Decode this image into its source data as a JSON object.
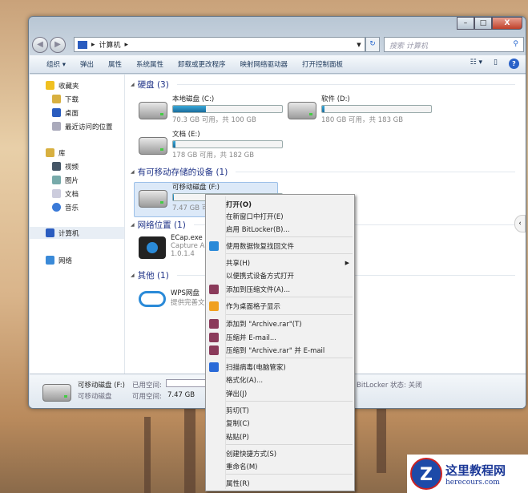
{
  "window": {
    "controls": {
      "minimize": "–",
      "maximize": "□",
      "close": "X"
    }
  },
  "address": {
    "path": "计算机",
    "search_placeholder": "搜索 计算机"
  },
  "toolbar": {
    "items": [
      "组织 ▾",
      "弹出",
      "属性",
      "系统属性",
      "卸载或更改程序",
      "映射网络驱动器",
      "打开控制面板"
    ]
  },
  "sidebar": {
    "favorites": "收藏夹",
    "fav_items": [
      "下载",
      "桌面",
      "最近访问的位置"
    ],
    "library": "库",
    "lib_items": [
      "视频",
      "图片",
      "文档",
      "音乐"
    ],
    "computer": "计算机",
    "network": "网络"
  },
  "groups": {
    "hdd": "硬盘 (3)",
    "removable": "有可移动存储的设备 (1)",
    "network": "网络位置 (1)",
    "other": "其他 (1)"
  },
  "drives": [
    {
      "name": "本地磁盘 (C:)",
      "size": "70.3 GB 可用，共 100 GB",
      "used_pct": 30
    },
    {
      "name": "软件 (D:)",
      "size": "180 GB 可用，共 183 GB",
      "used_pct": 2
    },
    {
      "name": "文档 (E:)",
      "size": "178 GB 可用，共 182 GB",
      "used_pct": 2
    },
    {
      "name": "可移动磁盘 (F:)",
      "size": "7.47 GB 可用",
      "used_pct": 1
    }
  ],
  "network_item": {
    "name": "ECap.exe",
    "desc": "Capture Ap",
    "ver": "1.0.1.4"
  },
  "other_item": {
    "name": "WPS网盘",
    "desc": "提供完善文"
  },
  "details": {
    "name": "可移动磁盘 (F:)",
    "type": "可移动磁盘",
    "used_label": "已用空间:",
    "free_label": "可用空间:",
    "free": "7.47 GB",
    "bitlocker": "BitLocker 状态: 关闭"
  },
  "context_menu": [
    "打开(O)",
    "在新窗口中打开(E)",
    "启用 BitLocker(B)...",
    "使用数据恢复找回文件",
    "共享(H)",
    "以便携式设备方式打开",
    "添加到压缩文件(A)...",
    "作为桌面格子显示",
    "添加到 \"Archive.rar\"(T)",
    "压缩并 E-mail...",
    "压缩到 \"Archive.rar\" 并 E-mail",
    "扫描病毒(电脑管家)",
    "格式化(A)...",
    "弹出(J)",
    "剪切(T)",
    "复制(C)",
    "粘贴(P)",
    "创建快捷方式(S)",
    "重命名(M)",
    "属性(R)"
  ],
  "watermark": {
    "title": "这里教程网",
    "url": "herecours.com"
  }
}
